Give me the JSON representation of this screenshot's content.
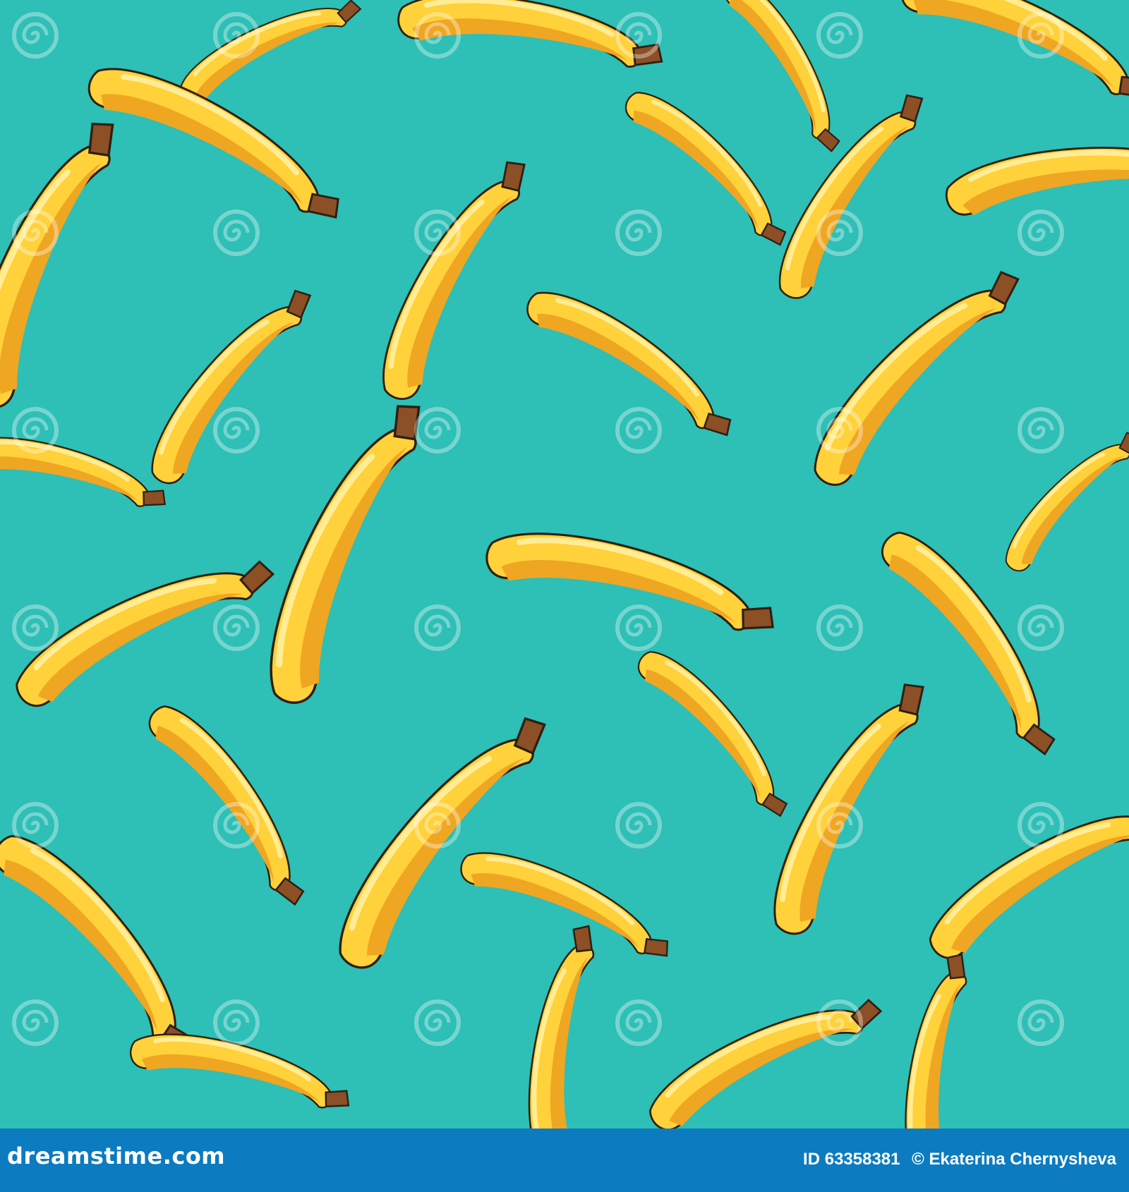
{
  "pattern": {
    "background_color": "#2ebfb6",
    "banana_fill": "#ffd13a",
    "banana_shade": "#efa622",
    "banana_highlight": "#fff1a6",
    "outline": "#2d1f12",
    "stem": "#8c4f26",
    "watermark_icon": "dreamstime-spiral-icon",
    "watermark_text": "dreamstime"
  },
  "footer": {
    "background_color": "#0c7bbf",
    "logo_text": "dreamstime.com",
    "image_id": "ID 63358381",
    "author": "© Ekaterina Chernysheva"
  }
}
